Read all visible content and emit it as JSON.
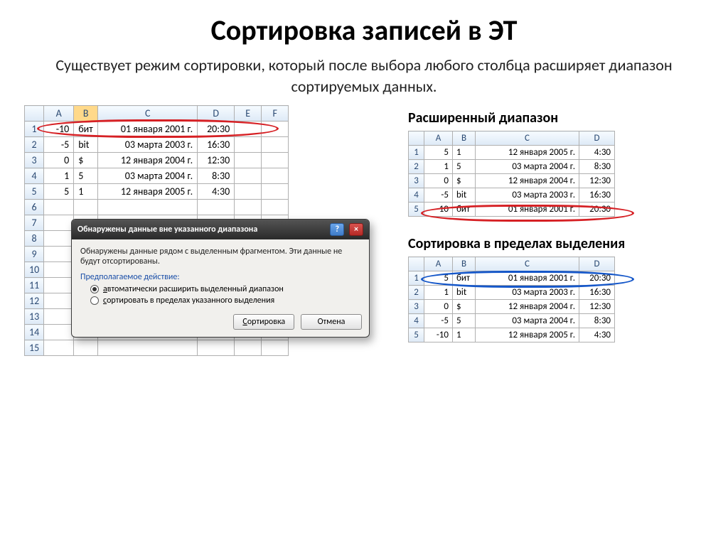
{
  "title": "Сортировка записей в ЭТ",
  "subtitle": "Существует режим сортировки, который после выбора любого столбца расширяет диапазон сортируемых данных.",
  "captions": {
    "extended": "Расширенный диапазон",
    "within": "Сортировка в пределах выделения"
  },
  "main_sheet": {
    "cols": [
      "A",
      "B",
      "C",
      "D",
      "E",
      "F"
    ],
    "row_nums": [
      1,
      2,
      3,
      4,
      5,
      6,
      7,
      8,
      9,
      10,
      11,
      12,
      13,
      14,
      15
    ],
    "rows": [
      {
        "A": "-10",
        "B": "бит",
        "C": "01 января 2001 г.",
        "D": "20:30"
      },
      {
        "A": "-5",
        "B": "bit",
        "C": "03 марта 2003 г.",
        "D": "16:30"
      },
      {
        "A": "0",
        "B": "$",
        "C": "12 января 2004 г.",
        "D": "12:30"
      },
      {
        "A": "1",
        "B": "5",
        "C": "03 марта 2004 г.",
        "D": "8:30"
      },
      {
        "A": "5",
        "B": "1",
        "C": "12 января 2005 г.",
        "D": "4:30"
      }
    ]
  },
  "extended_sheet": {
    "cols": [
      "A",
      "B",
      "C",
      "D"
    ],
    "rows": [
      {
        "A": "5",
        "B": "1",
        "C": "12 января 2005 г.",
        "D": "4:30"
      },
      {
        "A": "1",
        "B": "5",
        "C": "03 марта 2004 г.",
        "D": "8:30"
      },
      {
        "A": "0",
        "B": "$",
        "C": "12 января 2004 г.",
        "D": "12:30"
      },
      {
        "A": "-5",
        "B": "bit",
        "C": "03 марта 2003 г.",
        "D": "16:30"
      },
      {
        "A": "-10",
        "B": "бит",
        "C": "01 января 2001 г.",
        "D": "20:30"
      }
    ]
  },
  "within_sheet": {
    "cols": [
      "A",
      "B",
      "C",
      "D"
    ],
    "rows": [
      {
        "A": "5",
        "B": "бит",
        "C": "01 января 2001 г.",
        "D": "20:30"
      },
      {
        "A": "1",
        "B": "bit",
        "C": "03 марта 2003 г.",
        "D": "16:30"
      },
      {
        "A": "0",
        "B": "$",
        "C": "12 января 2004 г.",
        "D": "12:30"
      },
      {
        "A": "-5",
        "B": "5",
        "C": "03 марта 2004 г.",
        "D": "8:30"
      },
      {
        "A": "-10",
        "B": "1",
        "C": "12 января 2005 г.",
        "D": "4:30"
      }
    ]
  },
  "dialog": {
    "title": "Обнаружены данные вне указанного диапазона",
    "message": "Обнаружены данные рядом с выделенным фрагментом. Эти данные не будут отсортированы.",
    "section": "Предполагаемое действие:",
    "opt1": "автоматически расширить выделенный диапазон",
    "opt2": "сортировать в пределах указанного выделения",
    "btn_sort": "Сортировка",
    "btn_cancel": "Отмена"
  }
}
